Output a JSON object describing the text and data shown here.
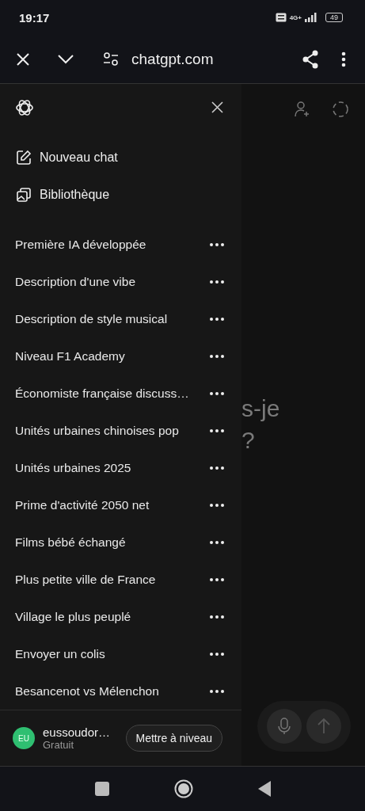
{
  "status_bar": {
    "time": "19:17",
    "network": "4G+",
    "battery": "49"
  },
  "browser_bar": {
    "url": "chatgpt.com"
  },
  "sidebar": {
    "actions": [
      {
        "kind": "new",
        "label": "Nouveau chat"
      },
      {
        "kind": "library",
        "label": "Bibliothèque"
      }
    ],
    "chats": [
      {
        "title": "Première IA développée"
      },
      {
        "title": "Description d'une vibe"
      },
      {
        "title": "Description de style musical"
      },
      {
        "title": "Niveau F1 Academy"
      },
      {
        "title": "Économiste française discuss…"
      },
      {
        "title": "Unités urbaines chinoises pop"
      },
      {
        "title": "Unités urbaines 2025"
      },
      {
        "title": "Prime d'activité 2050 net"
      },
      {
        "title": "Films bébé échangé"
      },
      {
        "title": "Plus petite ville de France"
      },
      {
        "title": "Village le plus peuplé"
      },
      {
        "title": "Envoyer un colis"
      },
      {
        "title": "Besancenot vs Mélenchon"
      }
    ],
    "account": {
      "initials": "EU",
      "color": "#2fbf71",
      "name": "eussoudor…",
      "plan": "Gratuit",
      "upgrade_button": "Mettre à niveau"
    }
  },
  "background_page": {
    "heading_lines": [
      "s-je",
      "?"
    ]
  }
}
